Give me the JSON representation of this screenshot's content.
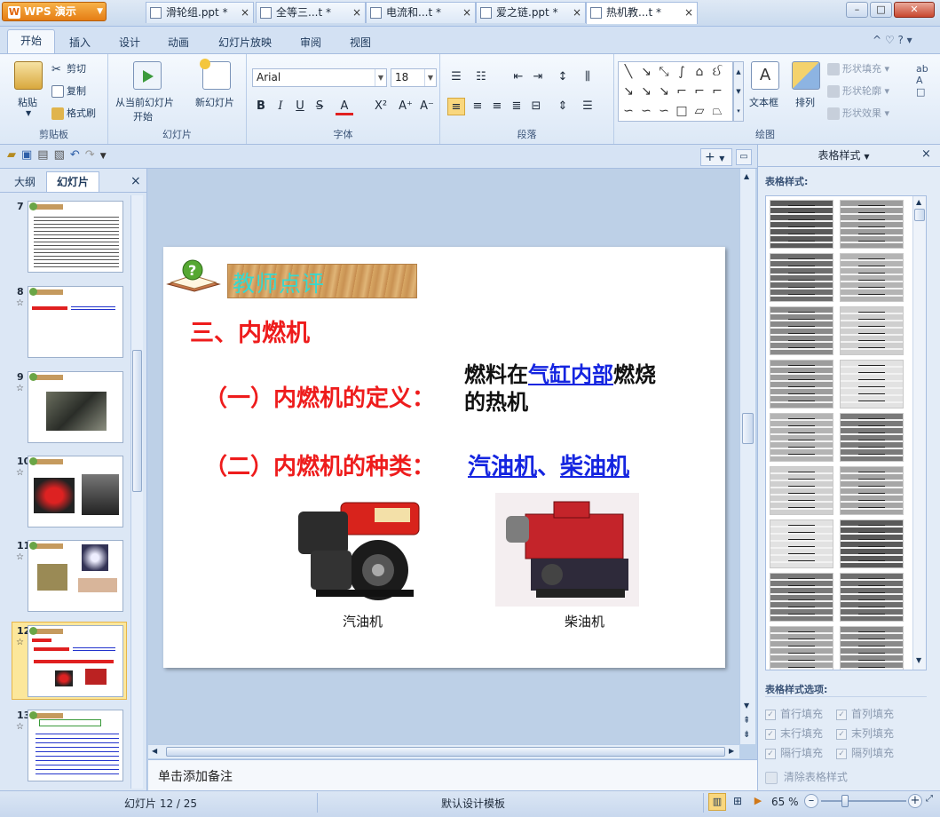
{
  "app": {
    "menu_button": "WPS 演示",
    "window_title": "热机教学课件.ppt *"
  },
  "menu": {
    "tabs": [
      "开始",
      "插入",
      "设计",
      "动画",
      "幻灯片放映",
      "审阅",
      "视图"
    ]
  },
  "ribbon": {
    "clipboard": {
      "paste": "粘贴",
      "cut": "剪切",
      "copy": "复制",
      "format_painter": "格式刷",
      "group": "剪贴板"
    },
    "slides": {
      "from_current_1": "从当前幻灯片",
      "from_current_2": "开始",
      "new_slide": "新幻灯片",
      "group": "幻灯片"
    },
    "font": {
      "name": "Arial",
      "size": "18",
      "group": "字体",
      "bold": "B",
      "italic": "I",
      "underline": "U",
      "strike": "S",
      "color": "A",
      "superscript": "X²",
      "grow": "A⁺",
      "shrink": "A⁻"
    },
    "paragraph": {
      "group": "段落"
    },
    "drawing": {
      "textbox": "文本框",
      "arrange": "排列",
      "fill": "形状填充",
      "outline": "形状轮廓",
      "effect": "形状效果",
      "group": "绘图"
    }
  },
  "doc_tabs": [
    {
      "label": "滑轮组.ppt *"
    },
    {
      "label": "全等三...t *"
    },
    {
      "label": "电流和...t *"
    },
    {
      "label": "爱之链.ppt *"
    },
    {
      "label": "热机教...t *"
    }
  ],
  "left_panel": {
    "tab_outline": "大纲",
    "tab_slides": "幻灯片",
    "close": "×",
    "thumbnails": [
      {
        "num": "7",
        "star": ""
      },
      {
        "num": "8",
        "star": "☆"
      },
      {
        "num": "9",
        "star": "☆"
      },
      {
        "num": "10",
        "star": "☆"
      },
      {
        "num": "11",
        "star": "☆"
      },
      {
        "num": "12",
        "star": "☆"
      },
      {
        "num": "13",
        "star": "☆"
      }
    ]
  },
  "slide": {
    "header_label": "教师点评",
    "heading": "三、内燃机",
    "definition_label": "（一）内燃机的定义：",
    "definition_text_1": "燃料在",
    "definition_link": "气缸内部",
    "definition_text_2": "燃烧",
    "definition_text_3": "的热机",
    "kinds_label": "（二）内燃机的种类：",
    "kind_gasoline": "汽油机",
    "kind_sep": "、",
    "kind_diesel": "柴油机",
    "caption_gasoline": "汽油机",
    "caption_diesel": "柴油机"
  },
  "notes": {
    "placeholder": "单击添加备注"
  },
  "right_panel": {
    "title": "表格样式",
    "styles_label": "表格样式:",
    "options_label": "表格样式选项:",
    "options": [
      {
        "label": "首行填充",
        "checked": true
      },
      {
        "label": "首列填充",
        "checked": true
      },
      {
        "label": "末行填充",
        "checked": true
      },
      {
        "label": "末列填充",
        "checked": true
      },
      {
        "label": "隔行填充",
        "checked": true
      },
      {
        "label": "隔列填充",
        "checked": true
      }
    ],
    "clear": "清除表格样式"
  },
  "status": {
    "slide_info": "幻灯片 12 / 25",
    "template": "默认设计模板",
    "zoom": "65 %"
  },
  "colors": {
    "accent_red": "#ee1c1c",
    "link_blue": "#1525e0",
    "header_cyan": "#36d9d0"
  }
}
